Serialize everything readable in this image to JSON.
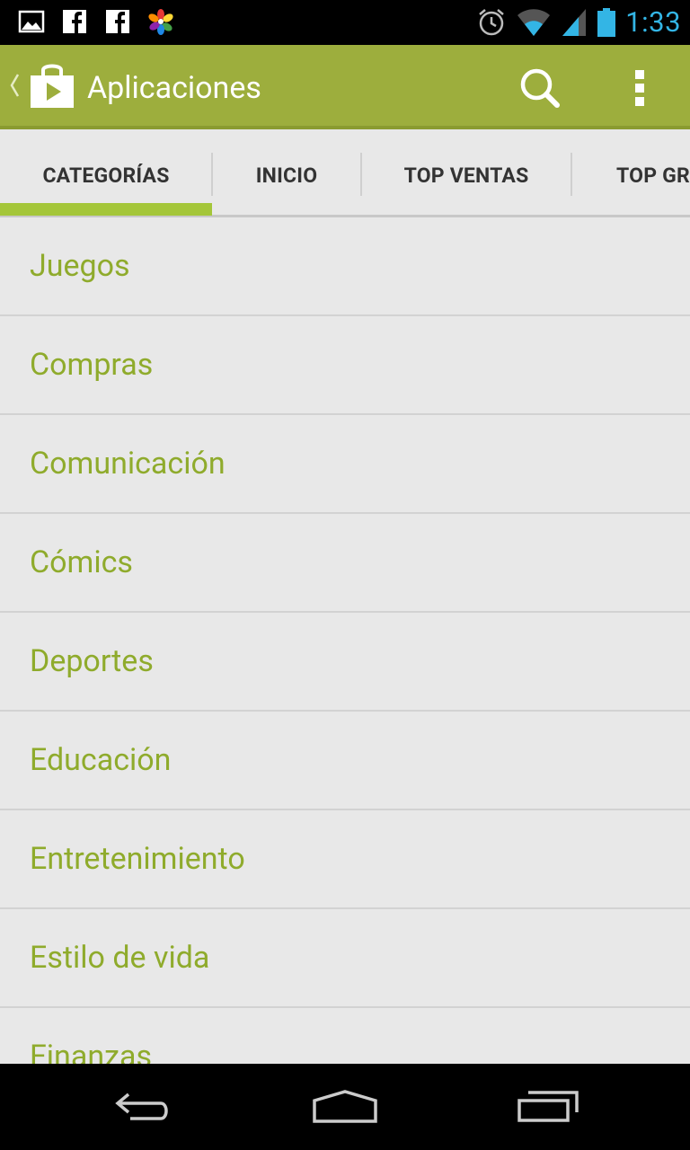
{
  "status_bar": {
    "time": "1:33",
    "left_icons": [
      "gallery-icon",
      "facebook-icon",
      "facebook-icon",
      "pinwheel-app-icon"
    ],
    "right_icons": [
      "alarm-icon",
      "wifi-icon",
      "signal-icon",
      "battery-icon"
    ],
    "time_color": "#33b5e5"
  },
  "action_bar": {
    "title": "Aplicaciones",
    "background": "#9dae3d",
    "icons": [
      "up-caret-icon",
      "play-store-icon",
      "search-icon",
      "overflow-menu-icon"
    ]
  },
  "tabs": [
    {
      "label": "CATEGORÍAS",
      "selected": true
    },
    {
      "label": "INICIO",
      "selected": false
    },
    {
      "label": "TOP VENTAS",
      "selected": false
    },
    {
      "label": "TOP GRATIS",
      "selected": false
    }
  ],
  "accent_color": "#a4c639",
  "categories": [
    "Juegos",
    "Compras",
    "Comunicación",
    "Cómics",
    "Deportes",
    "Educación",
    "Entretenimiento",
    "Estilo de vida",
    "Finanzas"
  ],
  "nav_bar": {
    "icons": [
      "back-icon",
      "home-icon",
      "recent-apps-icon"
    ]
  }
}
